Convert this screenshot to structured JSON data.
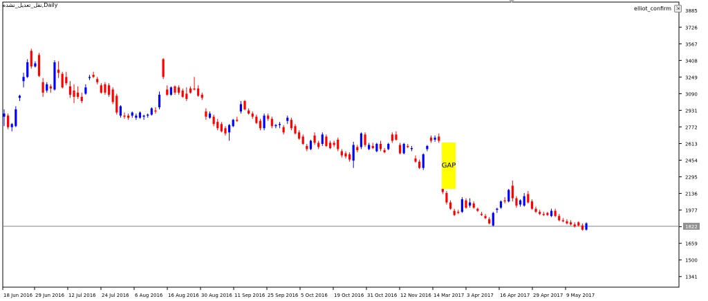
{
  "chart_title": "نقل_تعدیل_نشده,Daily",
  "indicator": {
    "name": "elliot_confirm",
    "icon": "expand-icon"
  },
  "colors": {
    "background": "#ffffff",
    "frame": "#000000",
    "bullish": "#0000ff",
    "bearish": "#ff0000",
    "gap_fill": "#ffff00",
    "price_line": "#808080"
  },
  "chart_data": {
    "type": "candlestick",
    "title": "نقل_تعدیل_نشده,Daily",
    "xlabel": "",
    "ylabel": "",
    "ylim": [
      1240,
      3966
    ],
    "y_ticks": [
      "3885",
      "3726",
      "3567",
      "3408",
      "3249",
      "3090",
      "2931",
      "2772",
      "2613",
      "2454",
      "2295",
      "2136",
      "1977",
      "1818",
      "1659",
      "1500",
      "1341"
    ],
    "x_ticks": [
      "18 Jun 2016",
      "29 Jun 2016",
      "12 Jul 2016",
      "24 Jul 2016",
      "6 Aug 2016",
      "16 Aug 2016",
      "30 Aug 2016",
      "11 Sep 2016",
      "25 Sep 2016",
      "5 Oct 2016",
      "19 Oct 2016",
      "31 Oct 2016",
      "12 Nov 2016",
      "14 Mar 2017",
      "3 Apr 2017",
      "16 Apr 2017",
      "29 Apr 2017",
      "9 May 2017"
    ],
    "current_price": 1822,
    "current_price_label": "1822",
    "annotation": {
      "text": "GAP",
      "from": 2620,
      "to": 2180
    },
    "grid": false,
    "candles": [
      {
        "o": 2870,
        "h": 2940,
        "l": 2780,
        "c": 2900
      },
      {
        "o": 2880,
        "h": 2900,
        "l": 2750,
        "c": 2770
      },
      {
        "o": 2770,
        "h": 2810,
        "l": 2730,
        "c": 2800
      },
      {
        "o": 2780,
        "h": 2970,
        "l": 2770,
        "c": 2940
      },
      {
        "o": 3050,
        "h": 3080,
        "l": 3020,
        "c": 3070
      },
      {
        "o": 3210,
        "h": 3290,
        "l": 3150,
        "c": 3250
      },
      {
        "o": 3250,
        "h": 3420,
        "l": 3240,
        "c": 3390
      },
      {
        "o": 3500,
        "h": 3520,
        "l": 3330,
        "c": 3350
      },
      {
        "o": 3350,
        "h": 3400,
        "l": 3340,
        "c": 3380
      },
      {
        "o": 3460,
        "h": 3480,
        "l": 3250,
        "c": 3260
      },
      {
        "o": 3200,
        "h": 3240,
        "l": 3060,
        "c": 3100
      },
      {
        "o": 3120,
        "h": 3200,
        "l": 3100,
        "c": 3180
      },
      {
        "o": 3160,
        "h": 3180,
        "l": 3100,
        "c": 3140
      },
      {
        "o": 3130,
        "h": 3410,
        "l": 3120,
        "c": 3390
      },
      {
        "o": 3320,
        "h": 3400,
        "l": 3240,
        "c": 3290
      },
      {
        "o": 3280,
        "h": 3300,
        "l": 3140,
        "c": 3150
      },
      {
        "o": 3250,
        "h": 3300,
        "l": 3170,
        "c": 3190
      },
      {
        "o": 3160,
        "h": 3210,
        "l": 3050,
        "c": 3080
      },
      {
        "o": 3120,
        "h": 3180,
        "l": 3000,
        "c": 3060
      },
      {
        "o": 3100,
        "h": 3160,
        "l": 3040,
        "c": 3060
      },
      {
        "o": 3060,
        "h": 3100,
        "l": 3000,
        "c": 3020
      },
      {
        "o": 3090,
        "h": 3180,
        "l": 3080,
        "c": 3150
      },
      {
        "o": 3240,
        "h": 3270,
        "l": 3220,
        "c": 3250
      },
      {
        "o": 3270,
        "h": 3300,
        "l": 3240,
        "c": 3250
      },
      {
        "o": 3230,
        "h": 3250,
        "l": 3180,
        "c": 3200
      },
      {
        "o": 3170,
        "h": 3190,
        "l": 3090,
        "c": 3100
      },
      {
        "o": 3180,
        "h": 3200,
        "l": 3080,
        "c": 3100
      },
      {
        "o": 3170,
        "h": 3190,
        "l": 3060,
        "c": 3080
      },
      {
        "o": 3130,
        "h": 3150,
        "l": 2990,
        "c": 3010
      },
      {
        "o": 3070,
        "h": 3090,
        "l": 2890,
        "c": 2910
      },
      {
        "o": 2880,
        "h": 2980,
        "l": 2860,
        "c": 2970
      },
      {
        "o": 2880,
        "h": 2910,
        "l": 2850,
        "c": 2870
      },
      {
        "o": 2880,
        "h": 2900,
        "l": 2840,
        "c": 2860
      },
      {
        "o": 2880,
        "h": 2920,
        "l": 2860,
        "c": 2910
      },
      {
        "o": 2860,
        "h": 2900,
        "l": 2840,
        "c": 2880
      },
      {
        "o": 2860,
        "h": 2920,
        "l": 2850,
        "c": 2910
      },
      {
        "o": 2870,
        "h": 2890,
        "l": 2840,
        "c": 2880
      },
      {
        "o": 2880,
        "h": 2900,
        "l": 2860,
        "c": 2890
      },
      {
        "o": 2890,
        "h": 2960,
        "l": 2880,
        "c": 2950
      },
      {
        "o": 2930,
        "h": 2960,
        "l": 2900,
        "c": 2920
      },
      {
        "o": 2960,
        "h": 3110,
        "l": 2940,
        "c": 3080
      },
      {
        "o": 3420,
        "h": 3430,
        "l": 3230,
        "c": 3250
      },
      {
        "o": 3130,
        "h": 3170,
        "l": 3070,
        "c": 3080
      },
      {
        "o": 3080,
        "h": 3160,
        "l": 3070,
        "c": 3150
      },
      {
        "o": 3160,
        "h": 3170,
        "l": 3080,
        "c": 3100
      },
      {
        "o": 3150,
        "h": 3170,
        "l": 3080,
        "c": 3100
      },
      {
        "o": 3120,
        "h": 3140,
        "l": 3050,
        "c": 3060
      },
      {
        "o": 3090,
        "h": 3150,
        "l": 3020,
        "c": 3040
      },
      {
        "o": 3140,
        "h": 3160,
        "l": 3090,
        "c": 3100
      },
      {
        "o": 3140,
        "h": 3250,
        "l": 3120,
        "c": 3130
      },
      {
        "o": 3140,
        "h": 3170,
        "l": 3060,
        "c": 3070
      },
      {
        "o": 3080,
        "h": 3100,
        "l": 3030,
        "c": 3050
      },
      {
        "o": 2920,
        "h": 2950,
        "l": 2840,
        "c": 2870
      },
      {
        "o": 2860,
        "h": 2920,
        "l": 2850,
        "c": 2900
      },
      {
        "o": 2870,
        "h": 2890,
        "l": 2780,
        "c": 2800
      },
      {
        "o": 2820,
        "h": 2850,
        "l": 2740,
        "c": 2760
      },
      {
        "o": 2800,
        "h": 2820,
        "l": 2720,
        "c": 2730
      },
      {
        "o": 2760,
        "h": 2780,
        "l": 2690,
        "c": 2710
      },
      {
        "o": 2720,
        "h": 2800,
        "l": 2640,
        "c": 2790
      },
      {
        "o": 2780,
        "h": 2850,
        "l": 2770,
        "c": 2840
      },
      {
        "o": 2840,
        "h": 2870,
        "l": 2820,
        "c": 2830
      },
      {
        "o": 2920,
        "h": 3020,
        "l": 2900,
        "c": 2990
      },
      {
        "o": 3020,
        "h": 3030,
        "l": 2930,
        "c": 2940
      },
      {
        "o": 2930,
        "h": 2950,
        "l": 2890,
        "c": 2900
      },
      {
        "o": 2900,
        "h": 2920,
        "l": 2850,
        "c": 2870
      },
      {
        "o": 2870,
        "h": 2890,
        "l": 2800,
        "c": 2810
      },
      {
        "o": 2830,
        "h": 2850,
        "l": 2740,
        "c": 2760
      },
      {
        "o": 2760,
        "h": 2900,
        "l": 2740,
        "c": 2880
      },
      {
        "o": 2880,
        "h": 2900,
        "l": 2830,
        "c": 2850
      },
      {
        "o": 2850,
        "h": 2870,
        "l": 2760,
        "c": 2780
      },
      {
        "o": 2780,
        "h": 2800,
        "l": 2760,
        "c": 2790
      },
      {
        "o": 2790,
        "h": 2820,
        "l": 2760,
        "c": 2800
      },
      {
        "o": 2770,
        "h": 2790,
        "l": 2700,
        "c": 2720
      },
      {
        "o": 2830,
        "h": 2880,
        "l": 2800,
        "c": 2860
      },
      {
        "o": 2840,
        "h": 2860,
        "l": 2740,
        "c": 2760
      },
      {
        "o": 2780,
        "h": 2800,
        "l": 2700,
        "c": 2710
      },
      {
        "o": 2720,
        "h": 2740,
        "l": 2650,
        "c": 2660
      },
      {
        "o": 2680,
        "h": 2700,
        "l": 2600,
        "c": 2610
      },
      {
        "o": 2590,
        "h": 2610,
        "l": 2540,
        "c": 2560
      },
      {
        "o": 2560,
        "h": 2650,
        "l": 2550,
        "c": 2640
      },
      {
        "o": 2690,
        "h": 2720,
        "l": 2600,
        "c": 2620
      },
      {
        "o": 2620,
        "h": 2640,
        "l": 2560,
        "c": 2580
      },
      {
        "o": 2610,
        "h": 2720,
        "l": 2590,
        "c": 2700
      },
      {
        "o": 2680,
        "h": 2700,
        "l": 2580,
        "c": 2590
      },
      {
        "o": 2620,
        "h": 2640,
        "l": 2560,
        "c": 2570
      },
      {
        "o": 2620,
        "h": 2640,
        "l": 2580,
        "c": 2600
      },
      {
        "o": 2650,
        "h": 2670,
        "l": 2540,
        "c": 2560
      },
      {
        "o": 2540,
        "h": 2560,
        "l": 2480,
        "c": 2500
      },
      {
        "o": 2520,
        "h": 2540,
        "l": 2470,
        "c": 2490
      },
      {
        "o": 2510,
        "h": 2530,
        "l": 2440,
        "c": 2460
      },
      {
        "o": 2450,
        "h": 2630,
        "l": 2380,
        "c": 2600
      },
      {
        "o": 2580,
        "h": 2600,
        "l": 2530,
        "c": 2550
      },
      {
        "o": 2580,
        "h": 2720,
        "l": 2560,
        "c": 2710
      },
      {
        "o": 2700,
        "h": 2720,
        "l": 2580,
        "c": 2600
      },
      {
        "o": 2560,
        "h": 2620,
        "l": 2550,
        "c": 2600
      },
      {
        "o": 2590,
        "h": 2620,
        "l": 2560,
        "c": 2570
      },
      {
        "o": 2540,
        "h": 2620,
        "l": 2530,
        "c": 2610
      },
      {
        "o": 2610,
        "h": 2640,
        "l": 2540,
        "c": 2560
      },
      {
        "o": 2550,
        "h": 2570,
        "l": 2520,
        "c": 2530
      },
      {
        "o": 2560,
        "h": 2620,
        "l": 2550,
        "c": 2610
      },
      {
        "o": 2700,
        "h": 2720,
        "l": 2620,
        "c": 2640
      },
      {
        "o": 2700,
        "h": 2730,
        "l": 2640,
        "c": 2650
      },
      {
        "o": 2600,
        "h": 2620,
        "l": 2510,
        "c": 2520
      },
      {
        "o": 2520,
        "h": 2620,
        "l": 2510,
        "c": 2610
      },
      {
        "o": 2590,
        "h": 2610,
        "l": 2570,
        "c": 2580
      },
      {
        "o": 2560,
        "h": 2590,
        "l": 2540,
        "c": 2570
      },
      {
        "o": 2470,
        "h": 2500,
        "l": 2430,
        "c": 2440
      },
      {
        "o": 2440,
        "h": 2460,
        "l": 2370,
        "c": 2380
      },
      {
        "o": 2380,
        "h": 2520,
        "l": 2360,
        "c": 2510
      },
      {
        "o": 2560,
        "h": 2600,
        "l": 2540,
        "c": 2590
      },
      {
        "o": 2670,
        "h": 2690,
        "l": 2620,
        "c": 2640
      },
      {
        "o": 2650,
        "h": 2690,
        "l": 2630,
        "c": 2670
      },
      {
        "o": 2680,
        "h": 2710,
        "l": 2620,
        "c": 2640
      },
      {
        "o": 2180,
        "h": 2240,
        "l": 2130,
        "c": 2150
      },
      {
        "o": 2140,
        "h": 2160,
        "l": 2030,
        "c": 2050
      },
      {
        "o": 2050,
        "h": 2070,
        "l": 1980,
        "c": 1990
      },
      {
        "o": 1970,
        "h": 1990,
        "l": 1920,
        "c": 1930
      },
      {
        "o": 1960,
        "h": 1980,
        "l": 1940,
        "c": 1950
      },
      {
        "o": 1960,
        "h": 2100,
        "l": 1950,
        "c": 2080
      },
      {
        "o": 2070,
        "h": 2090,
        "l": 1990,
        "c": 2000
      },
      {
        "o": 2020,
        "h": 2090,
        "l": 2000,
        "c": 2050
      },
      {
        "o": 2040,
        "h": 2060,
        "l": 1990,
        "c": 2000
      },
      {
        "o": 1990,
        "h": 2000,
        "l": 1960,
        "c": 1970
      },
      {
        "o": 1940,
        "h": 1960,
        "l": 1920,
        "c": 1930
      },
      {
        "o": 1920,
        "h": 1940,
        "l": 1890,
        "c": 1900
      },
      {
        "o": 1890,
        "h": 1910,
        "l": 1840,
        "c": 1850
      },
      {
        "o": 1830,
        "h": 1960,
        "l": 1820,
        "c": 1950
      },
      {
        "o": 1980,
        "h": 2000,
        "l": 1950,
        "c": 1990
      },
      {
        "o": 2000,
        "h": 2070,
        "l": 1990,
        "c": 2060
      },
      {
        "o": 2070,
        "h": 2100,
        "l": 2040,
        "c": 2060
      },
      {
        "o": 2060,
        "h": 2180,
        "l": 2050,
        "c": 2170
      },
      {
        "o": 2210,
        "h": 2260,
        "l": 2060,
        "c": 2090
      },
      {
        "o": 2090,
        "h": 2110,
        "l": 2000,
        "c": 2020
      },
      {
        "o": 2030,
        "h": 2080,
        "l": 2010,
        "c": 2070
      },
      {
        "o": 2020,
        "h": 2140,
        "l": 2010,
        "c": 2110
      },
      {
        "o": 2130,
        "h": 2160,
        "l": 2040,
        "c": 2050
      },
      {
        "o": 2060,
        "h": 2080,
        "l": 1980,
        "c": 1990
      },
      {
        "o": 1990,
        "h": 2010,
        "l": 1950,
        "c": 1960
      },
      {
        "o": 1960,
        "h": 1980,
        "l": 1930,
        "c": 1940
      },
      {
        "o": 1940,
        "h": 1960,
        "l": 1920,
        "c": 1930
      },
      {
        "o": 1950,
        "h": 1960,
        "l": 1920,
        "c": 1930
      },
      {
        "o": 1920,
        "h": 1990,
        "l": 1910,
        "c": 1970
      },
      {
        "o": 1970,
        "h": 1990,
        "l": 1910,
        "c": 1920
      },
      {
        "o": 1920,
        "h": 1940,
        "l": 1870,
        "c": 1880
      },
      {
        "o": 1880,
        "h": 1900,
        "l": 1860,
        "c": 1870
      },
      {
        "o": 1870,
        "h": 1890,
        "l": 1840,
        "c": 1850
      },
      {
        "o": 1860,
        "h": 1880,
        "l": 1830,
        "c": 1840
      },
      {
        "o": 1840,
        "h": 1860,
        "l": 1810,
        "c": 1820
      },
      {
        "o": 1860,
        "h": 1870,
        "l": 1820,
        "c": 1830
      },
      {
        "o": 1830,
        "h": 1850,
        "l": 1780,
        "c": 1790
      },
      {
        "o": 1790,
        "h": 1860,
        "l": 1780,
        "c": 1850
      }
    ]
  }
}
